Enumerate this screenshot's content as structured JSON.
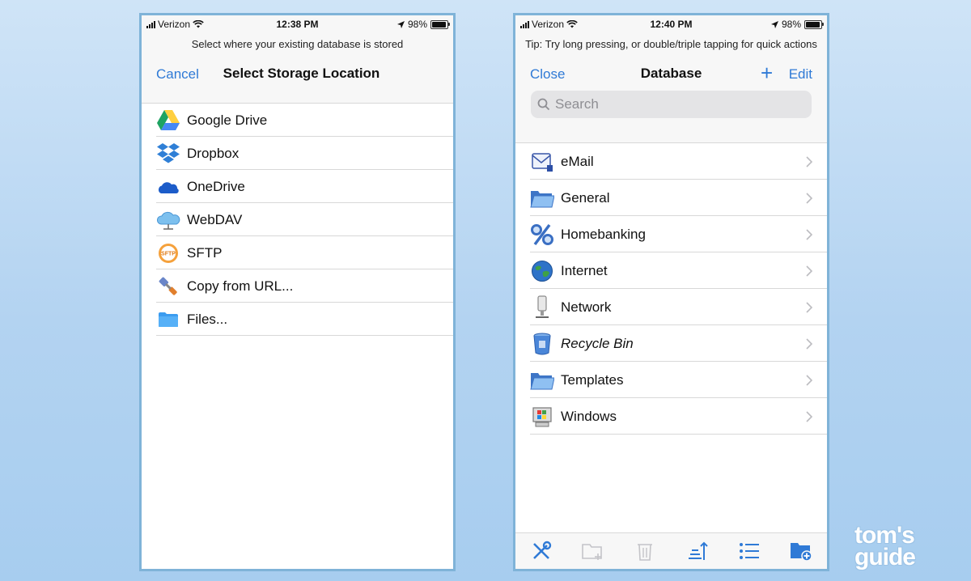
{
  "left": {
    "status": {
      "carrier": "Verizon",
      "time": "12:38 PM",
      "battery": "98%"
    },
    "hint": "Select where your existing database is stored",
    "nav": {
      "cancel": "Cancel",
      "title": "Select Storage Location"
    },
    "items": [
      {
        "label": "Google Drive",
        "icon": "google-drive-icon"
      },
      {
        "label": "Dropbox",
        "icon": "dropbox-icon"
      },
      {
        "label": "OneDrive",
        "icon": "onedrive-icon"
      },
      {
        "label": "WebDAV",
        "icon": "webdav-cloud-icon"
      },
      {
        "label": "SFTP",
        "icon": "sftp-icon"
      },
      {
        "label": "Copy from URL...",
        "icon": "plug-icon"
      },
      {
        "label": "Files...",
        "icon": "folder-icon"
      }
    ]
  },
  "right": {
    "status": {
      "carrier": "Verizon",
      "time": "12:40 PM",
      "battery": "98%"
    },
    "tip": "Tip: Try long pressing, or double/triple tapping for quick actions",
    "nav": {
      "close": "Close",
      "title": "Database",
      "add": "+",
      "edit": "Edit"
    },
    "search": {
      "placeholder": "Search"
    },
    "groups": [
      {
        "label": "eMail",
        "icon": "email-envelope-icon"
      },
      {
        "label": "General",
        "icon": "folder-icon"
      },
      {
        "label": "Homebanking",
        "icon": "percent-icon"
      },
      {
        "label": "Internet",
        "icon": "globe-icon"
      },
      {
        "label": "Network",
        "icon": "network-plug-icon"
      },
      {
        "label": "Recycle Bin",
        "icon": "trash-can-icon"
      },
      {
        "label": "Templates",
        "icon": "folder-icon"
      },
      {
        "label": "Windows",
        "icon": "windows-computer-icon"
      }
    ],
    "toolbar": [
      "wrench-screwdriver-icon",
      "new-entry-folder-icon",
      "trash-icon",
      "sort-icon",
      "list-icon",
      "new-folder-icon"
    ]
  },
  "watermark": {
    "line1": "tom's",
    "line2": "guide"
  },
  "colors": {
    "accent": "#2f7ad6",
    "frame": "#7fb3d8"
  }
}
